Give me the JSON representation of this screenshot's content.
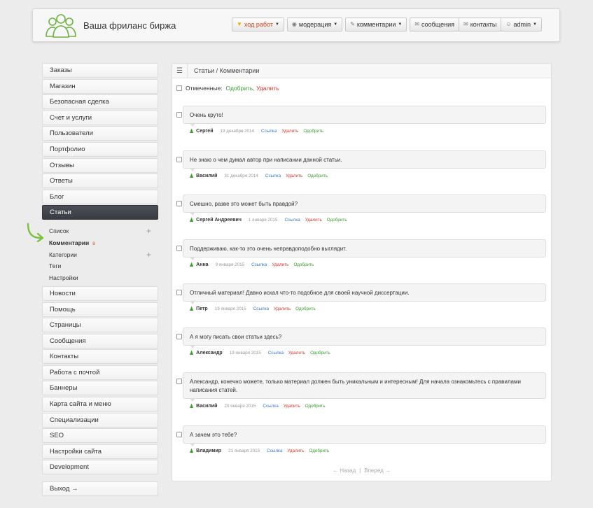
{
  "header": {
    "title": "Ваша фриланс биржа",
    "nav": [
      {
        "label": "ход работ",
        "icon": "shield-icon",
        "caret": true,
        "active": true
      },
      {
        "label": "модерация",
        "icon": "eye-icon",
        "caret": true
      },
      {
        "label": "комментарии",
        "icon": "pencil-icon",
        "caret": true
      }
    ],
    "nav_group": [
      {
        "label": "сообщения",
        "icon": "envelope-icon"
      },
      {
        "label": "контакты",
        "icon": "envelope-icon"
      },
      {
        "label": "admin",
        "icon": "user-icon",
        "caret": true
      }
    ]
  },
  "sidebar": {
    "items_top": [
      "Заказы",
      "Магазин",
      "Безопасная сделка",
      "Счет и услуги",
      "Пользователи",
      "Портфолио",
      "Отзывы",
      "Ответы",
      "Блог"
    ],
    "active": "Статьи",
    "sub": [
      {
        "label": "Список",
        "plus": true
      },
      {
        "label": "Комментарии",
        "count": "8",
        "current": true
      },
      {
        "label": "Категории",
        "plus": true
      },
      {
        "label": "Теги"
      },
      {
        "label": "Настройки"
      }
    ],
    "items_bottom": [
      "Новости",
      "Помощь",
      "Страницы",
      "Сообщения",
      "Контакты",
      "Работа с почтой",
      "Баннеры",
      "Карта сайта и меню",
      "Специализации",
      "SEO",
      "Настройки сайта",
      "Development"
    ],
    "logout": "Выход →"
  },
  "main": {
    "breadcrumb": "Статьи / Комментарии",
    "selected_label": "Отмеченные:",
    "approve": "Одобрить,",
    "delete": "Удалить",
    "link_label": "Ссылка",
    "delete_label": "Удалить",
    "approve_label": "Одобрить",
    "comments": [
      {
        "text": "Очень круто!",
        "author": "Сергей",
        "date": "19 декабря 2014"
      },
      {
        "text": "Не знаю о чем думал автор при написании данной статьи.",
        "author": "Василий",
        "date": "31 декабря 2014"
      },
      {
        "text": "Смешно, разве это может быть правдой?",
        "author": "Сергей Андреевич",
        "date": "1 января 2015"
      },
      {
        "text": "Поддерживаю, как-то это очень неправдоподобно выглядит.",
        "author": "Анна",
        "date": "9 января 2015"
      },
      {
        "text": "Отличный материал! Давно искал что-то подобное для своей научной диссертации.",
        "author": "Петр",
        "date": "19 января 2015"
      },
      {
        "text": "А я могу писать свои статьи здесь?",
        "author": "Александр",
        "date": "19 января 2015"
      },
      {
        "text": "Александр, конечно можете, только материал должен быть уникальным и интересным! Для начала ознакомьтесь с правилами написания статей.",
        "author": "Василий",
        "date": "20 января 2015"
      },
      {
        "text": "А зачем это тебе?",
        "author": "Владимир",
        "date": "21 января 2015"
      }
    ],
    "pager": {
      "prev": "← Назад",
      "sep": "|",
      "next": "Вперед →"
    }
  },
  "colors": {
    "accent_green": "#3a9e2f",
    "delete_red": "#d9362b",
    "link_blue": "#3b78c2",
    "active_dark": "#41454b"
  }
}
